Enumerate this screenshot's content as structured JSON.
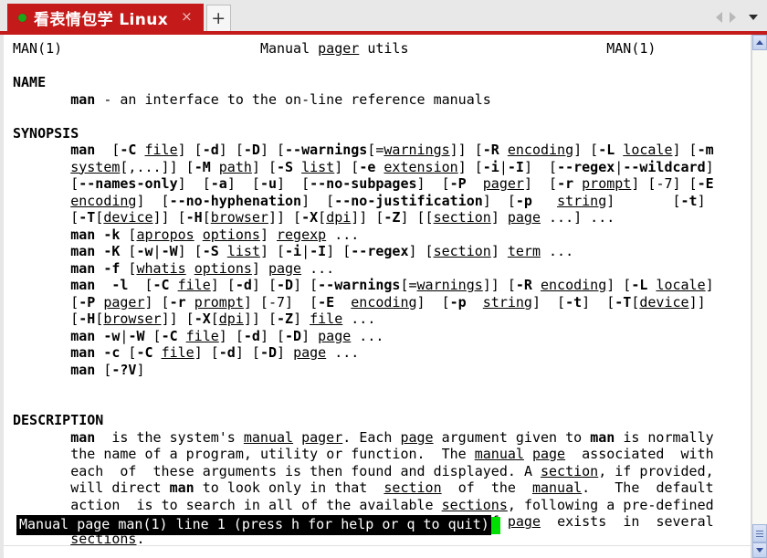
{
  "window": {
    "tab": {
      "title": "看表情包学 Linux",
      "close_label": "×",
      "dot_state": "active",
      "accent_color": "#c41a1a",
      "dot_color": "#1aa81a"
    },
    "new_tab_label": "+",
    "controls": {
      "prev_label": "",
      "next_label": "",
      "menu_label": ""
    }
  },
  "man_page": {
    "header": {
      "left": "MAN(1)",
      "center": "Manual pager utils",
      "right": "MAN(1)"
    },
    "sections": [
      {
        "heading": "NAME"
      },
      {
        "heading": "SYNOPSIS"
      },
      {
        "heading": "DESCRIPTION"
      }
    ],
    "name_body": "man - an interface to the on-line reference manuals",
    "lines": [
      {
        "id": "hdr",
        "text": "MAN(1)                        Manual pager utils                        MAN(1)"
      },
      {
        "id": "blank1",
        "text": ""
      },
      {
        "id": "s_name",
        "text": "NAME"
      },
      {
        "id": "name1",
        "text": "       man - an interface to the on-line reference manuals"
      },
      {
        "id": "blank2",
        "text": ""
      },
      {
        "id": "s_syn",
        "text": "SYNOPSIS"
      },
      {
        "id": "syn1",
        "text": "       man  [-C file] [-d] [-D] [--warnings[=warnings]] [-R encoding] [-L locale] [-m"
      },
      {
        "id": "syn2",
        "text": "       system[,...]] [-M path] [-S list] [-e extension] [-i|-I]  [--regex|--wildcard]"
      },
      {
        "id": "syn3",
        "text": "       [--names-only]  [-a]  [-u]  [--no-subpages]  [-P  pager]  [-r prompt] [-7] [-E"
      },
      {
        "id": "syn4",
        "text": "       encoding]  [--no-hyphenation]  [--no-justification]  [-p   string]       [-t]"
      },
      {
        "id": "syn5",
        "text": "       [-T[device]] [-H[browser]] [-X[dpi]] [-Z] [[section] page ...] ..."
      },
      {
        "id": "syn6",
        "text": "       man -k [apropos options] regexp ..."
      },
      {
        "id": "syn7",
        "text": "       man -K [-w|-W] [-S list] [-i|-I] [--regex] [section] term ..."
      },
      {
        "id": "syn8",
        "text": "       man -f [whatis options] page ..."
      },
      {
        "id": "syn9",
        "text": "       man  -l  [-C file] [-d] [-D] [--warnings[=warnings]] [-R encoding] [-L locale]"
      },
      {
        "id": "syn10",
        "text": "       [-P pager] [-r prompt] [-7]  [-E  encoding]  [-p  string]  [-t]  [-T[device]]"
      },
      {
        "id": "syn11",
        "text": "       [-H[browser]] [-X[dpi]] [-Z] file ..."
      },
      {
        "id": "syn12",
        "text": "       man -w|-W [-C file] [-d] [-D] page ..."
      },
      {
        "id": "syn13",
        "text": "       man -c [-C file] [-d] [-D] page ..."
      },
      {
        "id": "syn14",
        "text": "       man [-?V]"
      },
      {
        "id": "blank3",
        "text": ""
      },
      {
        "id": "blank4",
        "text": ""
      },
      {
        "id": "s_desc",
        "text": "DESCRIPTION"
      },
      {
        "id": "desc1",
        "text": "       man  is the system's manual pager. Each page argument given to man is normally"
      },
      {
        "id": "desc2",
        "text": "       the name of a program, utility or function.  The manual page  associated  with"
      },
      {
        "id": "desc3",
        "text": "       each  of  these arguments is then found and displayed. A section, if provided,"
      },
      {
        "id": "desc4",
        "text": "       will direct man to look only in that  section  of  the  manual.   The  default"
      },
      {
        "id": "desc5",
        "text": "       action  is to search in all of the available sections, following a pre-defined"
      },
      {
        "id": "desc6",
        "text": "       order and to show only the first page found, even if page  exists  in  several"
      },
      {
        "id": "desc7",
        "text": "       sections."
      }
    ]
  },
  "status_bar": {
    "text": "Manual page man(1) line 1 (press h for help or q to quit)",
    "cursor_color": "#00e000",
    "background_color": "#000000"
  },
  "scrollbar": {
    "up_label": "",
    "down_label": "",
    "thumb_position": "bottom"
  }
}
